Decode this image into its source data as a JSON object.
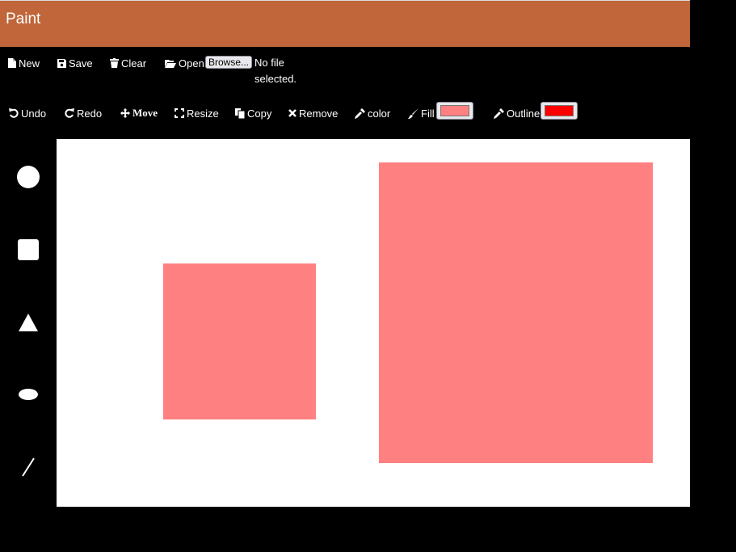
{
  "app": {
    "title": "Paint",
    "header_color": "#c0663a"
  },
  "toolbar1": {
    "new_label": "New",
    "save_label": "Save",
    "clear_label": "Clear",
    "open_label": "Open",
    "browse_label": "Browse...",
    "file_status": "No file selected."
  },
  "toolbar2": {
    "undo_label": "Undo",
    "redo_label": "Redo",
    "move_label": "Move",
    "resize_label": "Resize",
    "copy_label": "Copy",
    "remove_label": "Remove",
    "color_label": "color",
    "fill_label": "Fill",
    "fill_color": "#ff8080",
    "outline_label": "Outline",
    "outline_color": "#ff0000"
  },
  "tools": [
    {
      "name": "circle-icon"
    },
    {
      "name": "square-icon"
    },
    {
      "name": "triangle-icon"
    },
    {
      "name": "ellipse-icon"
    },
    {
      "name": "line-icon"
    }
  ],
  "canvas": {
    "background": "#ffffff",
    "shape_color": "#ff8080"
  }
}
